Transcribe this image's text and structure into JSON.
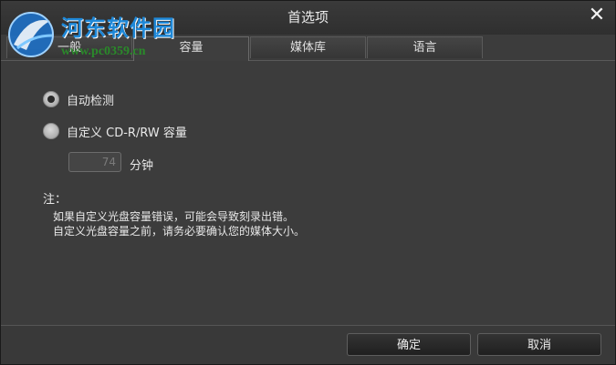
{
  "window": {
    "title": "首选项",
    "close_glyph": "✕"
  },
  "watermark": {
    "site_name": "河东软件园",
    "url": "www.pc0359.cn"
  },
  "tabs": [
    {
      "label": "一般",
      "active": false
    },
    {
      "label": "容量",
      "active": true
    },
    {
      "label": "媒体库",
      "active": false
    },
    {
      "label": "语言",
      "active": false
    }
  ],
  "capacity": {
    "options": [
      {
        "label": "自动检测",
        "selected": true
      },
      {
        "label": "自定义 CD-R/RW 容量",
        "selected": false
      }
    ],
    "minutes_value": "74",
    "minutes_unit": "分钟",
    "note_title": "注：",
    "note_lines": [
      "如果自定义光盘容量错误，可能会导致刻录出错。",
      "自定义光盘容量之前，请务必要确认您的媒体大小。"
    ]
  },
  "footer": {
    "ok_label": "确定",
    "cancel_label": "取消"
  }
}
